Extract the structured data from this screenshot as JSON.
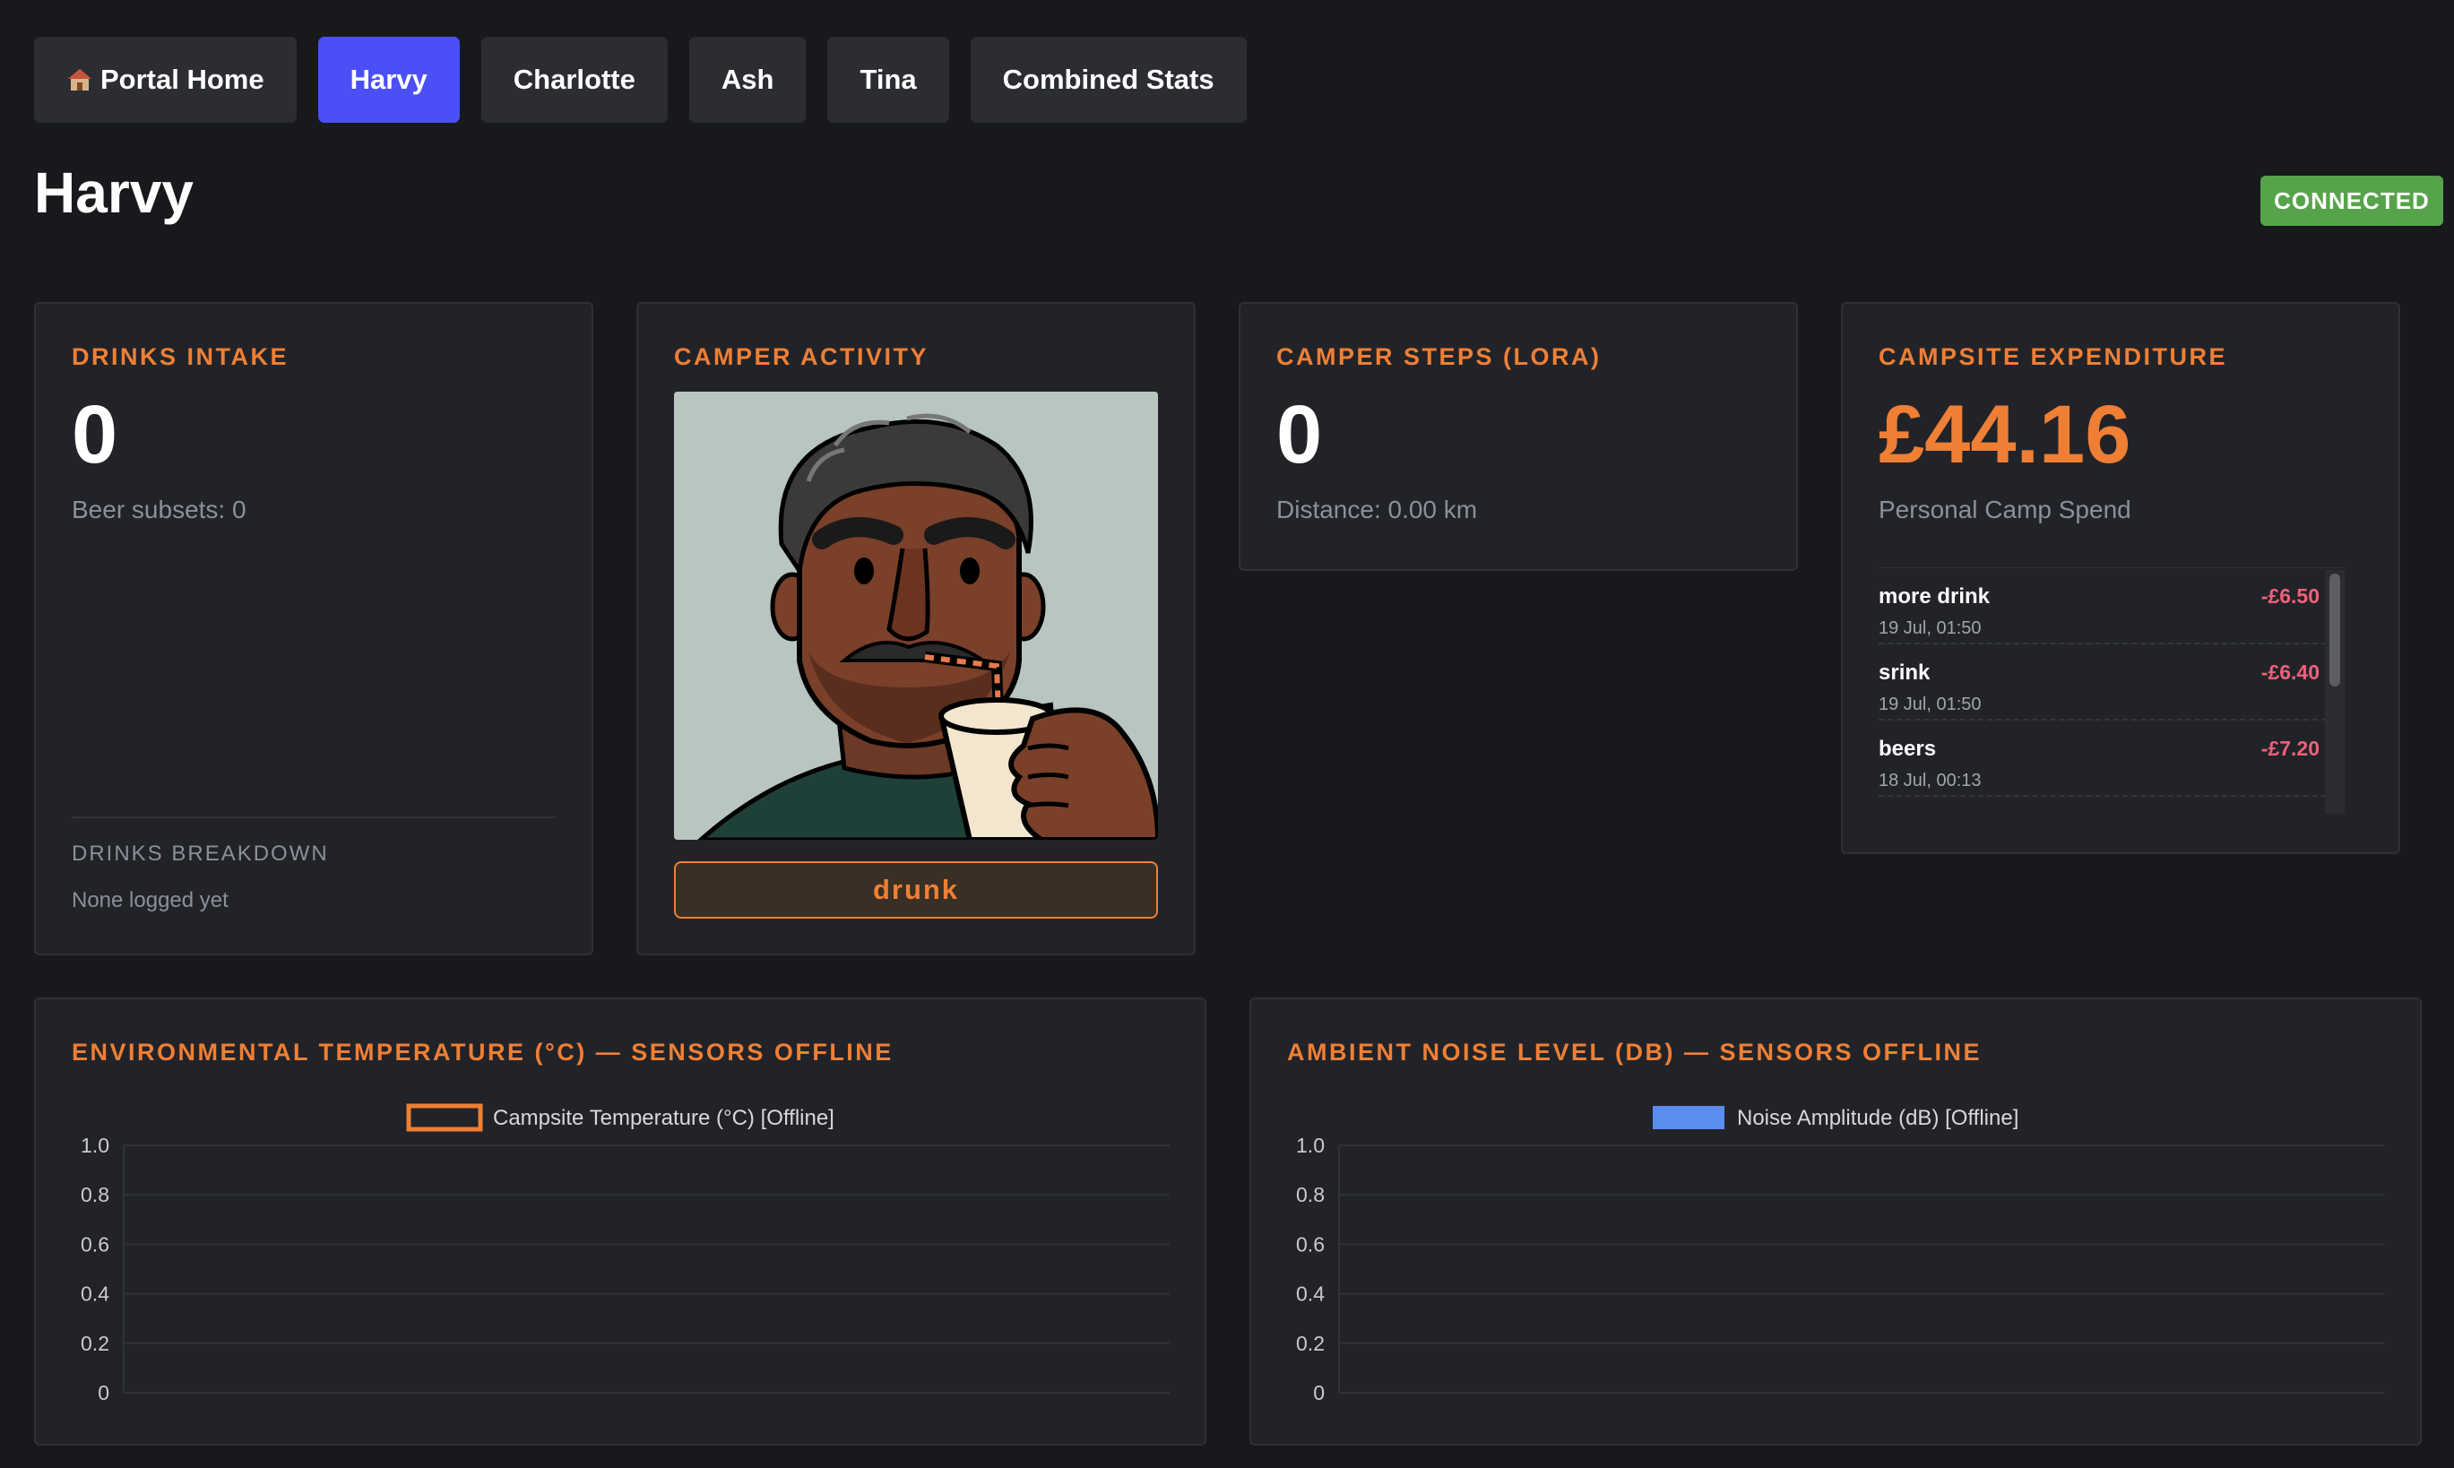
{
  "nav": {
    "items": [
      {
        "label": "Portal Home",
        "icon": "home-icon",
        "active": false
      },
      {
        "label": "Harvy",
        "active": true
      },
      {
        "label": "Charlotte",
        "active": false
      },
      {
        "label": "Ash",
        "active": false
      },
      {
        "label": "Tina",
        "active": false
      },
      {
        "label": "Combined Stats",
        "active": false
      }
    ]
  },
  "header": {
    "title": "Harvy",
    "connection_status": "CONNECTED"
  },
  "drinks": {
    "title": "DRINKS INTAKE",
    "value": "0",
    "subtitle": "Beer subsets: 0",
    "breakdown_title": "DRINKS BREAKDOWN",
    "breakdown_empty": "None logged yet"
  },
  "activity": {
    "title": "CAMPER ACTIVITY",
    "image": "camper-drinking-illustration",
    "status": "drunk"
  },
  "steps": {
    "title": "CAMPER STEPS (LORA)",
    "value": "0",
    "subtitle": "Distance: 0.00 km"
  },
  "spend": {
    "title": "CAMPSITE EXPENDITURE",
    "value": "£44.16",
    "subtitle": "Personal Camp Spend",
    "transactions": [
      {
        "name": "more drink",
        "date": "19 Jul, 01:50",
        "amount": "-£6.50"
      },
      {
        "name": "srink",
        "date": "19 Jul, 01:50",
        "amount": "-£6.40"
      },
      {
        "name": "beers",
        "date": "18 Jul, 00:13",
        "amount": "-£7.20"
      }
    ]
  },
  "colors": {
    "accent": "#ef7f34",
    "active_tab": "#4b4ff5",
    "connected": "#57a34b",
    "negative_amount": "#f0607a",
    "noise_series": "#5b8def"
  },
  "chart_data": [
    {
      "type": "bar",
      "title": "ENVIRONMENTAL TEMPERATURE (°C) — SENSORS OFFLINE",
      "series": [
        {
          "name": "Campsite Temperature (°C) [Offline]",
          "values": [],
          "color": "#ef7f34",
          "legend_style": "outline"
        }
      ],
      "categories": [],
      "ylim": [
        0,
        1.0
      ],
      "yticks": [
        "1.0",
        "0.8",
        "0.6",
        "0.4",
        "0.2",
        "0"
      ],
      "grid": true,
      "legend": "top-center"
    },
    {
      "type": "bar",
      "title": "AMBIENT NOISE LEVEL (DB) — SENSORS OFFLINE",
      "series": [
        {
          "name": "Noise Amplitude (dB) [Offline]",
          "values": [],
          "color": "#5b8def",
          "legend_style": "filled"
        }
      ],
      "categories": [],
      "ylim": [
        0,
        1.0
      ],
      "yticks": [
        "1.0",
        "0.8",
        "0.6",
        "0.4",
        "0.2",
        "0"
      ],
      "grid": true,
      "legend": "top-center"
    }
  ]
}
